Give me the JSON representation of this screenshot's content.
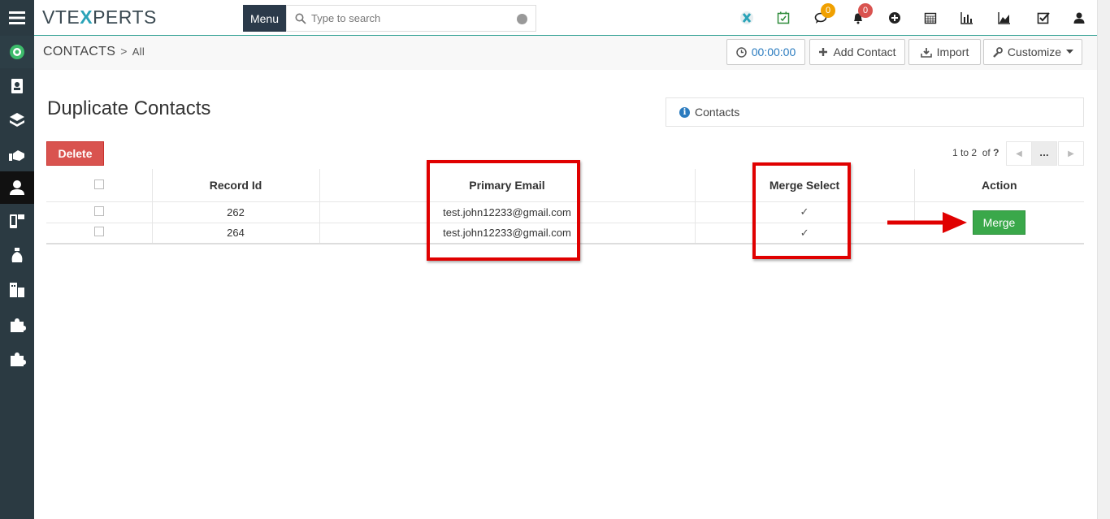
{
  "logo": {
    "prefix": "VTE",
    "x": "X",
    "suffix": "PERTS"
  },
  "topbar": {
    "menu_label": "Menu",
    "search_placeholder": "Type to search",
    "chat_count": "0",
    "notif_count": "0"
  },
  "breadcrumb": {
    "module": "CONTACTS",
    "separator": ">",
    "view": "All"
  },
  "subbar": {
    "timer": "00:00:00",
    "add_label": "Add Contact",
    "import_label": "Import",
    "customize_label": "Customize"
  },
  "page": {
    "title": "Duplicate Contacts",
    "module_label": "Contacts"
  },
  "actions": {
    "delete_label": "Delete",
    "merge_label": "Merge"
  },
  "pager": {
    "range": "1 to 2",
    "of": "of",
    "total": "?",
    "more": "..."
  },
  "table": {
    "headers": {
      "record_id": "Record Id",
      "primary_email": "Primary Email",
      "merge_select": "Merge Select",
      "action": "Action"
    },
    "rows": [
      {
        "record_id": "262",
        "email": "test.john12233@gmail.com",
        "merge_checked": "✓"
      },
      {
        "record_id": "264",
        "email": "test.john12233@gmail.com",
        "merge_checked": "✓"
      }
    ]
  },
  "colors": {
    "sidebar": "#2b3a42",
    "accent_green": "#3aa84a",
    "delete_red": "#d9534f",
    "highlight_red": "#e00000",
    "badge_orange": "#f0a000",
    "badge_red": "#d9534f"
  }
}
